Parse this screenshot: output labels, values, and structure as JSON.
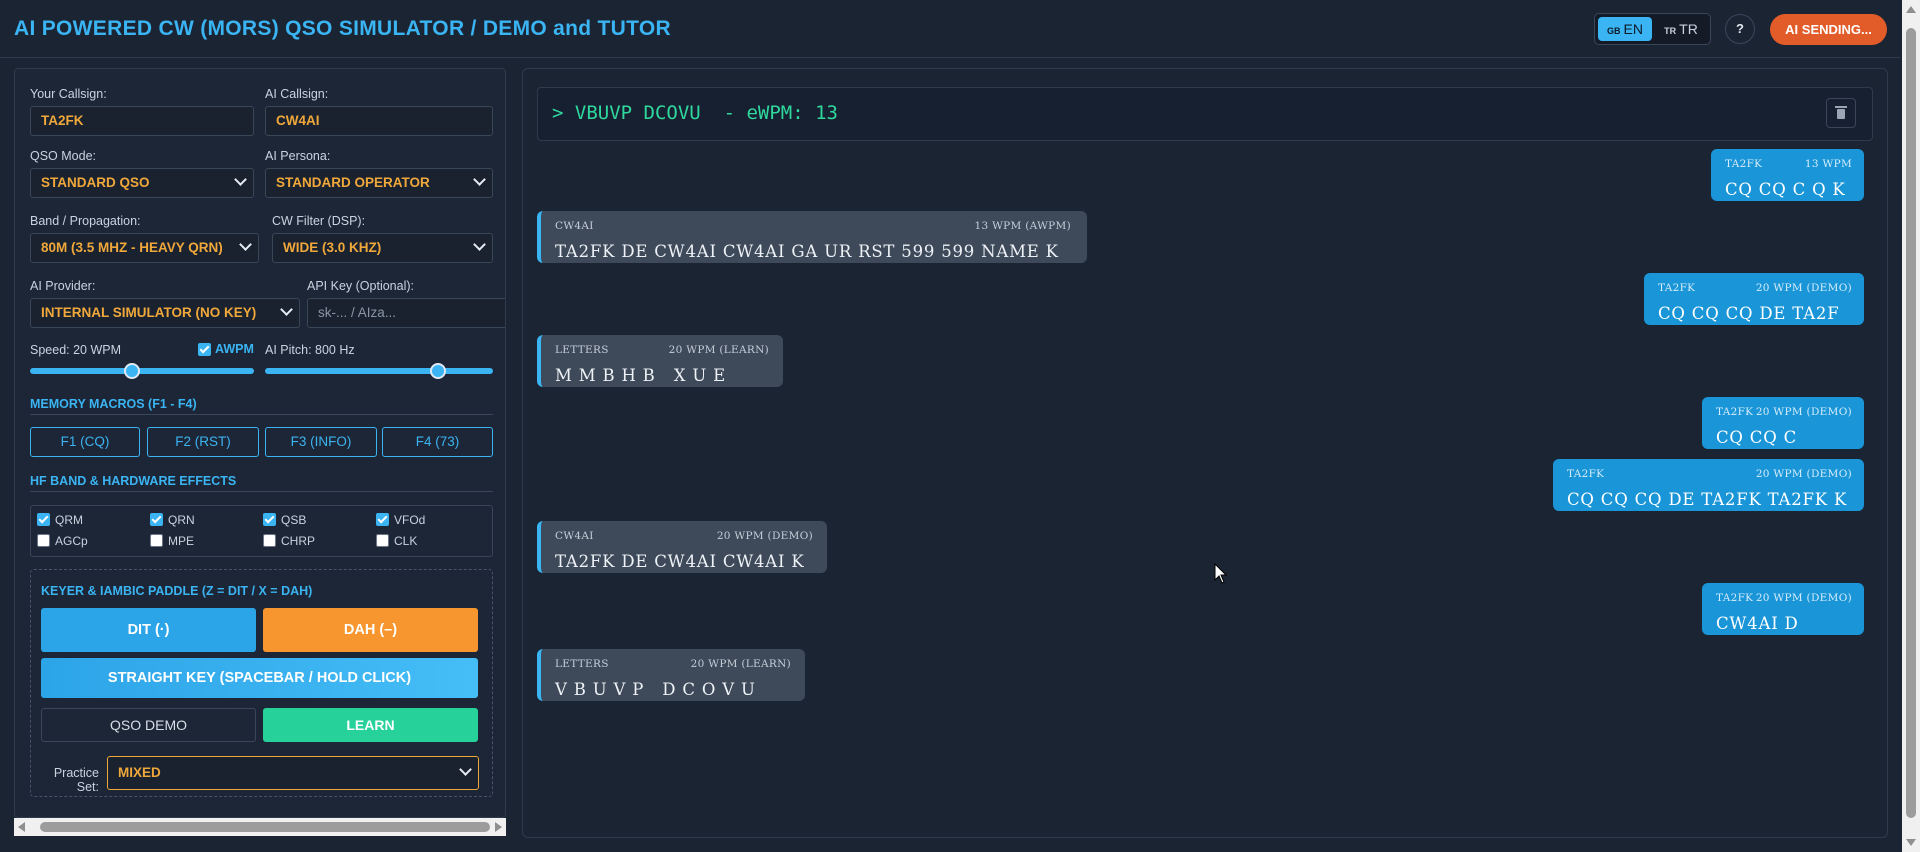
{
  "header": {
    "title": "AI POWERED CW (MORS) QSO SIMULATOR / DEMO and TUTOR",
    "lang_en_flag": "GB",
    "lang_en": "EN",
    "lang_tr_flag": "TR",
    "lang_tr": "TR",
    "help": "?",
    "ai_status": "AI SENDING..."
  },
  "settings": {
    "your_callsign_label": "Your Callsign:",
    "your_callsign": "TA2FK",
    "ai_callsign_label": "AI Callsign:",
    "ai_callsign": "CW4AI",
    "qso_mode_label": "QSO Mode:",
    "qso_mode": "STANDARD QSO",
    "ai_persona_label": "AI Persona:",
    "ai_persona": "STANDARD OPERATOR",
    "band_label": "Band / Propagation:",
    "band": "80M (3.5 MHZ - HEAVY QRN)",
    "cw_filter_label": "CW Filter (DSP):",
    "cw_filter": "WIDE (3.0 KHZ)",
    "ai_provider_label": "AI Provider:",
    "ai_provider": "INTERNAL SIMULATOR (NO KEY)",
    "api_key_label": "API Key (Optional):",
    "api_key_placeholder": "sk-... / AIza...",
    "speed_label": "Speed: 20 WPM",
    "speed_fraction": 0.45,
    "awpm_label": "AWPM",
    "awpm_checked": true,
    "pitch_label": "AI Pitch: 800 Hz",
    "pitch_fraction": 0.78
  },
  "macros": {
    "heading": "MEMORY MACROS (F1 - F4)",
    "items": [
      "F1 (CQ)",
      "F2 (RST)",
      "F3 (INFO)",
      "F4 (73)"
    ]
  },
  "effects": {
    "heading": "HF BAND & HARDWARE EFFECTS",
    "items": [
      {
        "label": "QRM",
        "checked": true
      },
      {
        "label": "QRN",
        "checked": true
      },
      {
        "label": "QSB",
        "checked": true
      },
      {
        "label": "VFOd",
        "checked": true
      },
      {
        "label": "AGCp",
        "checked": false
      },
      {
        "label": "MPE",
        "checked": false
      },
      {
        "label": "CHRP",
        "checked": false
      },
      {
        "label": "CLK",
        "checked": false
      }
    ]
  },
  "keyer": {
    "heading": "KEYER & IAMBIC PADDLE (Z = DIT / X = DAH)",
    "dit": "DIT (·)",
    "dah": "DAH (–)",
    "straight": "STRAIGHT KEY (SPACEBAR / HOLD CLICK)",
    "qso_demo": "QSO DEMO",
    "learn": "LEARN",
    "practice_label": "Practice Set:",
    "practice_value": "MIXED"
  },
  "terminal": {
    "text": "> VBUVP DCOVU  - eWPM: 13"
  },
  "messages": [
    {
      "side": "me",
      "sender": "TA2FK",
      "speed": "13 WPM",
      "text": "CQ CQ C Q K"
    },
    {
      "side": "ai",
      "sender": "CW4AI",
      "speed": "13 WPM (AWPM)",
      "text": "TA2FK DE CW4AI CW4AI GA UR RST 599 599 NAME K"
    },
    {
      "side": "me",
      "sender": "TA2FK",
      "speed": "20 WPM (DEMO)",
      "text": "CQ CQ CQ DE TA2F"
    },
    {
      "side": "ai",
      "sender": "LETTERS",
      "speed": "20 WPM (LEARN)",
      "text": "M M B H B   X U E"
    },
    {
      "side": "me",
      "sender": "TA2FK",
      "speed": "20 WPM (DEMO)",
      "text": "CQ CQ C"
    },
    {
      "side": "me",
      "sender": "TA2FK",
      "speed": "20 WPM (DEMO)",
      "text": "CQ CQ CQ DE TA2FK TA2FK K"
    },
    {
      "side": "ai",
      "sender": "CW4AI",
      "speed": "20 WPM (DEMO)",
      "text": "TA2FK DE CW4AI CW4AI K"
    },
    {
      "side": "me",
      "sender": "TA2FK",
      "speed": "20 WPM (DEMO)",
      "text": "CW4AI D"
    },
    {
      "side": "ai",
      "sender": "LETTERS",
      "speed": "20 WPM (LEARN)",
      "text": "V B U V P   D C O V U"
    }
  ],
  "colors": {
    "accent": "#3ab4f2",
    "dah": "#f7952f",
    "learn": "#27d29a",
    "value_text": "#f0a83a",
    "status": "#e25c2a",
    "terminal_text": "#2fd89c"
  }
}
